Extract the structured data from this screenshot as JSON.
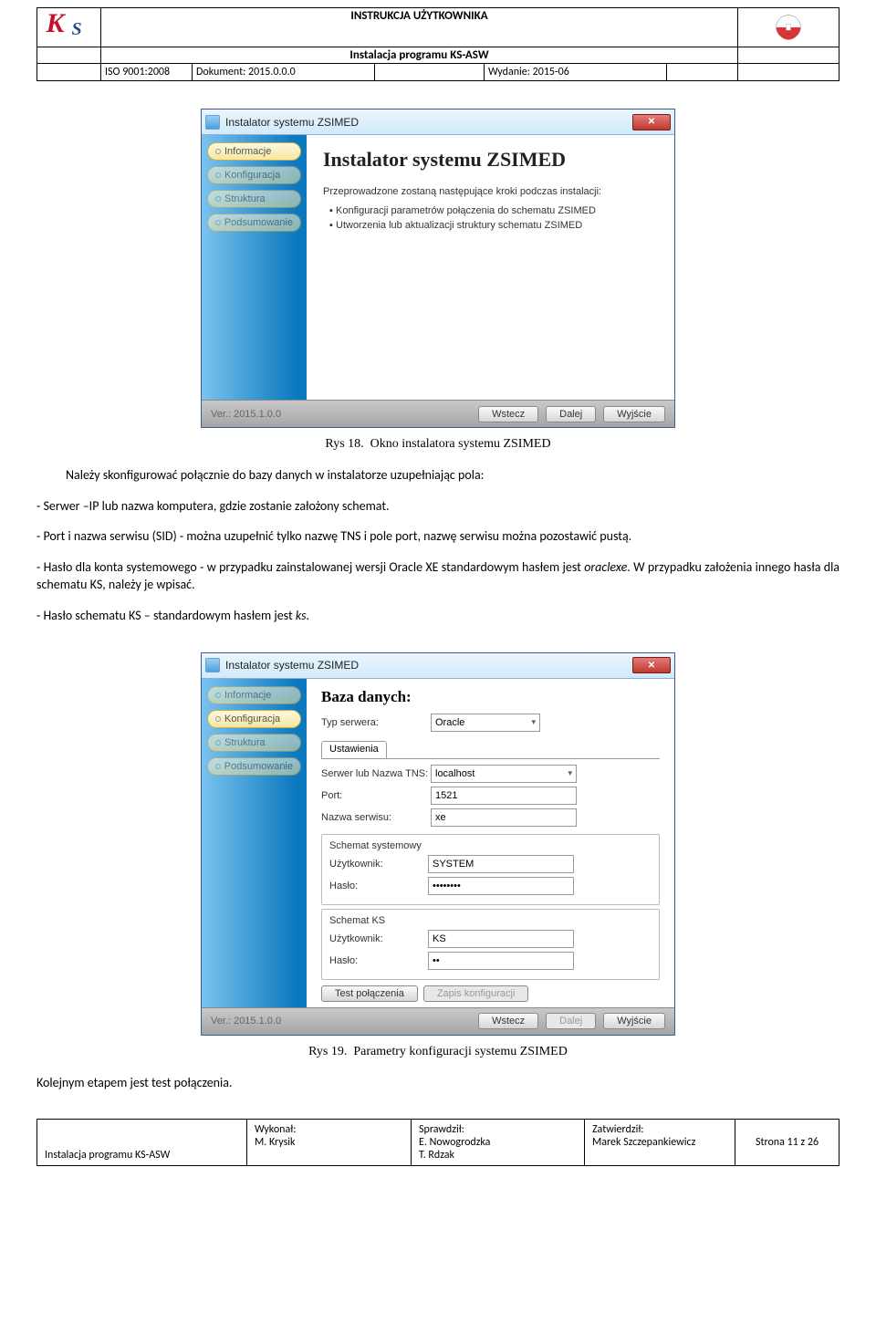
{
  "header": {
    "title1": "INSTRUKCJA UŻYTKOWNIKA",
    "title2": "Instalacja programu KS-ASW",
    "iso": "ISO 9001:2008",
    "dokument": "Dokument: 2015.0.0.0",
    "wydanie": "Wydanie: 2015-06"
  },
  "win1": {
    "title": "Instalator systemu ZSIMED",
    "close": "✕",
    "side": {
      "a": "Informacje",
      "b": "Konfiguracja",
      "c": "Struktura",
      "d": "Podsumowanie"
    },
    "heading": "Instalator systemu ZSIMED",
    "intro": "Przeprowadzone zostaną następujące kroki podczas instalacji:",
    "li1": "Konfiguracji parametrów połączenia do schematu ZSIMED",
    "li2": "Utworzenia lub aktualizacji struktury schematu ZSIMED",
    "ver": "Ver.: 2015.1.0.0",
    "wstecz": "Wstecz",
    "dalej": "Dalej",
    "wyjscie": "Wyjście"
  },
  "caption1_no": "Rys 18.",
  "caption1_txt": "Okno instalatora systemu ZSIMED",
  "p1": "Należy skonfigurować połącznie do bazy danych w instalatorze uzupełniając pola:",
  "p2": "- Serwer –IP lub nazwa komputera, gdzie zostanie założony schemat.",
  "p3": "- Port i nazwa serwisu (SID) - można uzupełnić tylko nazwę TNS i pole port, nazwę serwisu można pozostawić pustą.",
  "p4a": "- Hasło dla konta systemowego - w przypadku zainstalowanej wersji Oracle XE standardowym hasłem jest ",
  "p4b": "oraclexe",
  "p4c": ". W przypadku założenia innego hasła dla schematu KS, należy je wpisać.",
  "p5a": "- Hasło schematu KS – standardowym hasłem jest ",
  "p5b": "ks",
  "p5c": ".",
  "win2": {
    "title": "Instalator systemu ZSIMED",
    "close": "✕",
    "side": {
      "a": "Informacje",
      "b": "Konfiguracja",
      "c": "Struktura",
      "d": "Podsumowanie"
    },
    "heading": "Baza danych:",
    "typ_lbl": "Typ serwera:",
    "typ_val": "Oracle",
    "tab": "Ustawienia",
    "serwer_lbl": "Serwer lub Nazwa TNS:",
    "serwer_val": "localhost",
    "port_lbl": "Port:",
    "port_val": "1521",
    "nazwaserw_lbl": "Nazwa serwisu:",
    "nazwaserw_val": "xe",
    "schsys_legend": "Schemat systemowy",
    "user_lbl": "Użytkownik:",
    "user_sys_val": "SYSTEM",
    "pass_lbl": "Hasło:",
    "pass_sys_val": "••••••••",
    "schks_legend": "Schemat KS",
    "user_ks_val": "KS",
    "pass_ks_val": "••",
    "test": "Test połączenia",
    "zapis": "Zapis konfiguracji",
    "ver": "Ver.: 2015.1.0.0",
    "wstecz": "Wstecz",
    "dalej": "Dalej",
    "wyjscie": "Wyjście"
  },
  "caption2_no": "Rys 19.",
  "caption2_txt": "Parametry konfiguracji systemu ZSIMED",
  "p6": "Kolejnym etapem jest test połączenia.",
  "footer": {
    "c1": "Instalacja programu KS-ASW",
    "c2a": "Wykonał:",
    "c2b": "M. Krysik",
    "c3a": "Sprawdził:",
    "c3b": "E. Nowogrodzka",
    "c3c": "T. Rdzak",
    "c4a": "Zatwierdził:",
    "c4b": "Marek Szczepankiewicz",
    "c5": "Strona 11 z 26"
  }
}
